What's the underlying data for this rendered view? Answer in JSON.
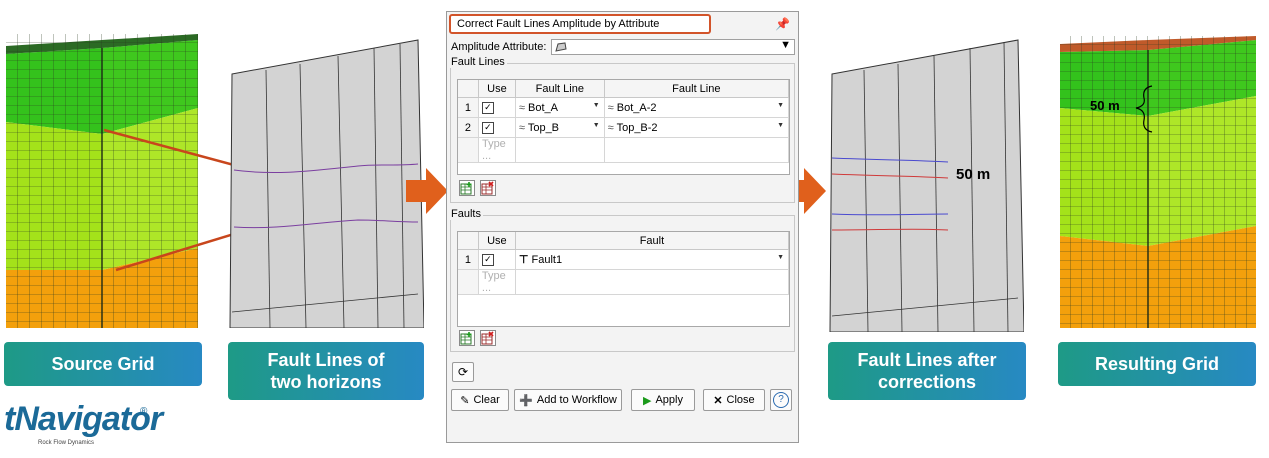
{
  "captions": {
    "source_grid": "Source Grid",
    "fault_lines_line1": "Fault Lines of",
    "fault_lines_line2": "two horizons",
    "after_line1": "Fault Lines after",
    "after_line2": "corrections",
    "resulting_grid": "Resulting Grid"
  },
  "annotations": {
    "after_distance": "50 m",
    "result_distance": "50 m"
  },
  "dialog": {
    "title": "Correct Fault Lines Amplitude by Attribute",
    "amplitude_label": "Amplitude Attribute:",
    "fault_lines_group": "Fault Lines",
    "fault_lines_table": {
      "headers": [
        "Use",
        "Fault Line",
        "Fault Line"
      ],
      "rows": [
        {
          "num": "1",
          "checked": true,
          "line1": "Bot_A",
          "line2": "Bot_A-2"
        },
        {
          "num": "2",
          "checked": true,
          "line1": "Top_B",
          "line2": "Top_B-2"
        }
      ],
      "placeholder": "Type ..."
    },
    "faults_group": "Faults",
    "faults_table": {
      "headers": [
        "Use",
        "Fault"
      ],
      "rows": [
        {
          "num": "1",
          "checked": true,
          "fault": "Fault1"
        }
      ],
      "placeholder": "Type ..."
    },
    "buttons": {
      "clear": "Clear",
      "add_to_workflow": "Add to Workflow",
      "apply": "Apply",
      "close": "Close",
      "help": "?"
    }
  },
  "logo": {
    "text": "tNavigator",
    "reg": "®",
    "sub": "Rock Flow Dynamics"
  },
  "colors": {
    "accent_orange": "#e0601c",
    "badge_start": "#1e9a86",
    "badge_end": "#2789c3",
    "title_border": "#d2542a",
    "grid_green": "#33c41c",
    "grid_lime": "#a3e21c",
    "grid_orange": "#f2a10c"
  }
}
